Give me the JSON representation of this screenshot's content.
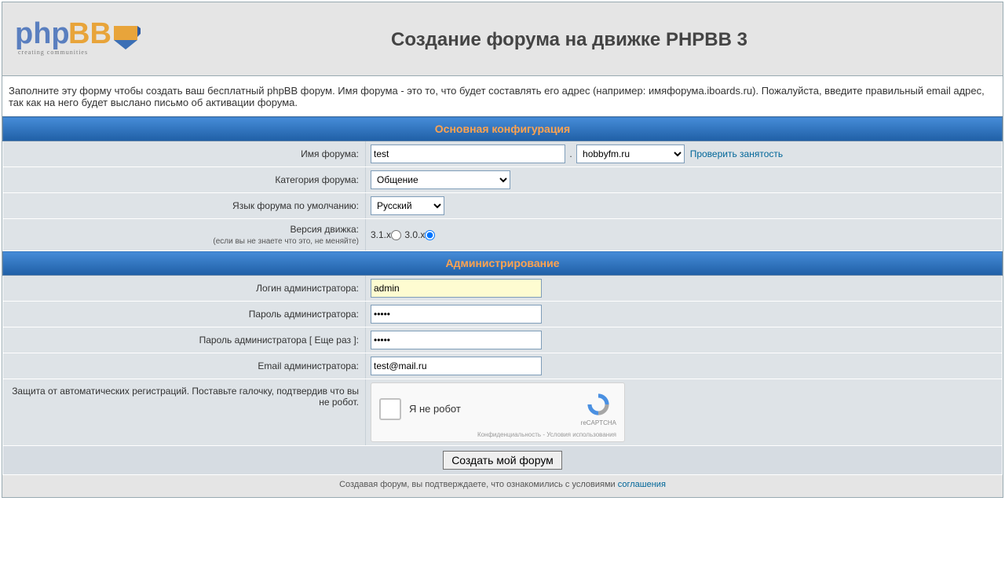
{
  "header": {
    "logo_main": "php",
    "logo_suffix": "BB",
    "logo_tagline": "creating communities",
    "title": "Создание форума на движке PHPBB 3"
  },
  "intro": "Заполните эту форму чтобы создать ваш бесплатный phpBB форум. Имя форума - это то, что будет составлять его адрес (например: имяфорума.iboards.ru). Пожалуйста, введите правильный email адрес, так как на него будет выслано письмо об активации форума.",
  "sections": {
    "config_title": "Основная конфигурация",
    "admin_title": "Администрирование"
  },
  "fields": {
    "forum_name": {
      "label": "Имя форума:",
      "value": "test",
      "domain_selected": "hobbyfm.ru",
      "check_link": "Проверить занятость"
    },
    "category": {
      "label": "Категория форума:",
      "selected": "Общение"
    },
    "language": {
      "label": "Язык форума по умолчанию:",
      "selected": "Русский"
    },
    "engine": {
      "label": "Версия движка:",
      "sublabel": "(если вы не знаете что это, не меняйте)",
      "opt1": "3.1.x",
      "opt2": "3.0.x",
      "selected": "3.0.x"
    },
    "admin_login": {
      "label": "Логин администратора:",
      "value": "admin"
    },
    "admin_pass": {
      "label": "Пароль администратора:",
      "value": "•••••"
    },
    "admin_pass2": {
      "label": "Пароль администратора [ Еще раз ]:",
      "value": "•••••"
    },
    "admin_email": {
      "label": "Email администратора:",
      "value": "test@mail.ru"
    },
    "captcha": {
      "label": "Защита от автоматических регистраций. Поставьте галочку, подтвердив что вы не робот.",
      "checkbox_label": "Я не робот",
      "brand": "reCAPTCHA",
      "privacy": "Конфиденциальность",
      "terms": "Условия использования",
      "sep": " - "
    }
  },
  "submit_label": "Создать мой форум",
  "footer": {
    "text": "Создавая форум, вы подтверждаете, что ознакомились с условиями ",
    "link": "соглашения"
  }
}
